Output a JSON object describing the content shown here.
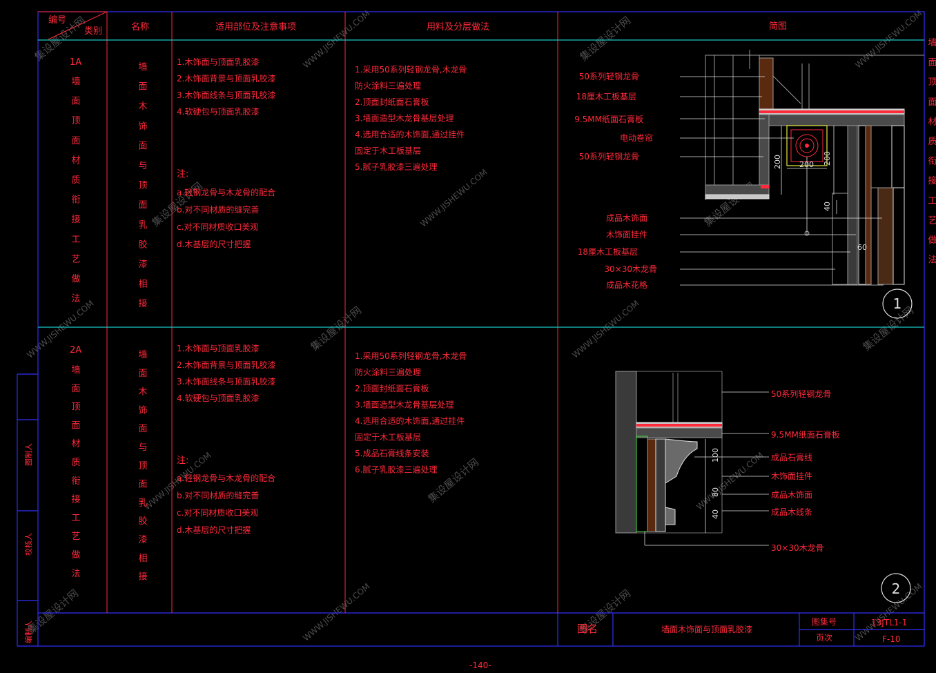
{
  "colors": {
    "background": "#000000",
    "frame": "#3030ff",
    "grid": "#ff2a3a",
    "divider": "#1ac8c8",
    "text_red": "#ff2a3a",
    "text_white": "#e8e8e8",
    "watermark": "#8a8a8a",
    "drawing_gray": "#9a9a9a",
    "drawing_white": "#e0e0e0",
    "drawing_yellow": "#e8e840",
    "drawing_green": "#40e040"
  },
  "header": {
    "code_label": "编号",
    "category_label": "类别",
    "name": "名称",
    "scope": "适用部位及注意事项",
    "materials": "用料及分层做法",
    "sketch": "简图"
  },
  "row1": {
    "code": "1A",
    "category_chars": [
      "墙",
      "面",
      "顶",
      "面",
      "材",
      "质",
      "衔",
      "接",
      "工",
      "艺",
      "做",
      "法"
    ],
    "name_chars": [
      "墙",
      "面",
      "木",
      "饰",
      "面",
      "与",
      "顶",
      "面",
      "乳",
      "胶",
      "漆",
      "相",
      "接"
    ],
    "scope_lines": [
      "1.木饰面与顶面乳胶漆",
      "2.木饰面背景与顶面乳胶漆",
      "3.木饰面线条与顶面乳胶漆",
      "4.软硬包与顶面乳胶漆"
    ],
    "note_label": "注:",
    "notes": [
      "a.轻钢龙骨与木龙骨的配合",
      "b.对不同材质的缝完善",
      "c.对不同材质收口美观",
      "d.木基层的尺寸把握"
    ],
    "material_lines": [
      "1.采用50系列轻钢龙骨,木龙骨",
      "防火涂料三遍处理",
      "2.顶面封纸面石膏板",
      "3.墙面造型木龙骨基层处理",
      "4.选用合适的木饰面,通过挂件",
      "固定于木工板基层",
      "5.腻子乳胶漆三遍处理"
    ],
    "labels": [
      "50系列轻钢龙骨",
      "18厘木工板基层",
      "9.5MM纸面石膏板",
      "电动卷帘",
      "50系列轻钢龙骨",
      "成品木饰面",
      "木饰面挂件",
      "18厘木工板基层",
      "30×30木龙骨",
      "成品木花格"
    ],
    "dims": [
      "200",
      "200",
      "200",
      "40",
      "60"
    ],
    "detail_no": "1"
  },
  "row2": {
    "code": "2A",
    "category_chars": [
      "墙",
      "面",
      "顶",
      "面",
      "材",
      "质",
      "衔",
      "接",
      "工",
      "艺",
      "做",
      "法"
    ],
    "name_chars": [
      "墙",
      "面",
      "木",
      "饰",
      "面",
      "与",
      "顶",
      "面",
      "乳",
      "胶",
      "漆",
      "相",
      "接"
    ],
    "scope_lines": [
      "1.木饰面与顶面乳胶漆",
      "2.木饰面背景与顶面乳胶漆",
      "3.木饰面线条与顶面乳胶漆",
      "4.软硬包与顶面乳胶漆"
    ],
    "note_label": "注:",
    "notes": [
      "a.轻钢龙骨与木龙骨的配合",
      "b.对不同材质的缝完善",
      "c.对不同材质收口美观",
      "d.木基层的尺寸把握"
    ],
    "material_lines": [
      "1.采用50系列轻钢龙骨,木龙骨",
      "防火涂料三遍处理",
      "2.顶面封纸面石膏板",
      "3.墙面造型木龙骨基层处理",
      "4.选用合适的木饰面,通过挂件",
      "固定于木工板基层",
      "5.成品石膏线条安装",
      "6.腻子乳胶漆三遍处理"
    ],
    "labels": [
      "50系列轻钢龙骨",
      "9.5MM纸面石膏板",
      "成品石膏线",
      "木饰面挂件",
      "成品木饰面",
      "成品木线条",
      "30×30木龙骨"
    ],
    "dims": [
      "100",
      "80",
      "40"
    ],
    "detail_no": "2"
  },
  "side_title": [
    "墙",
    "面",
    "顶",
    "面",
    "材",
    "质",
    "衔",
    "接",
    "工",
    "艺",
    "做",
    "法"
  ],
  "left_strip": [
    "图制人",
    "校核人",
    "编制人"
  ],
  "footer": {
    "title_label": "图名",
    "title": "墙面木饰面与顶面乳胶漆",
    "atlas_label": "图集号",
    "atlas_no": "13JTL1-1",
    "page_label": "页次",
    "page_no": "F-10"
  },
  "page_number": "-140-",
  "watermarks": [
    "集设屋设计网",
    "WWW.JISHEWU.COM"
  ]
}
